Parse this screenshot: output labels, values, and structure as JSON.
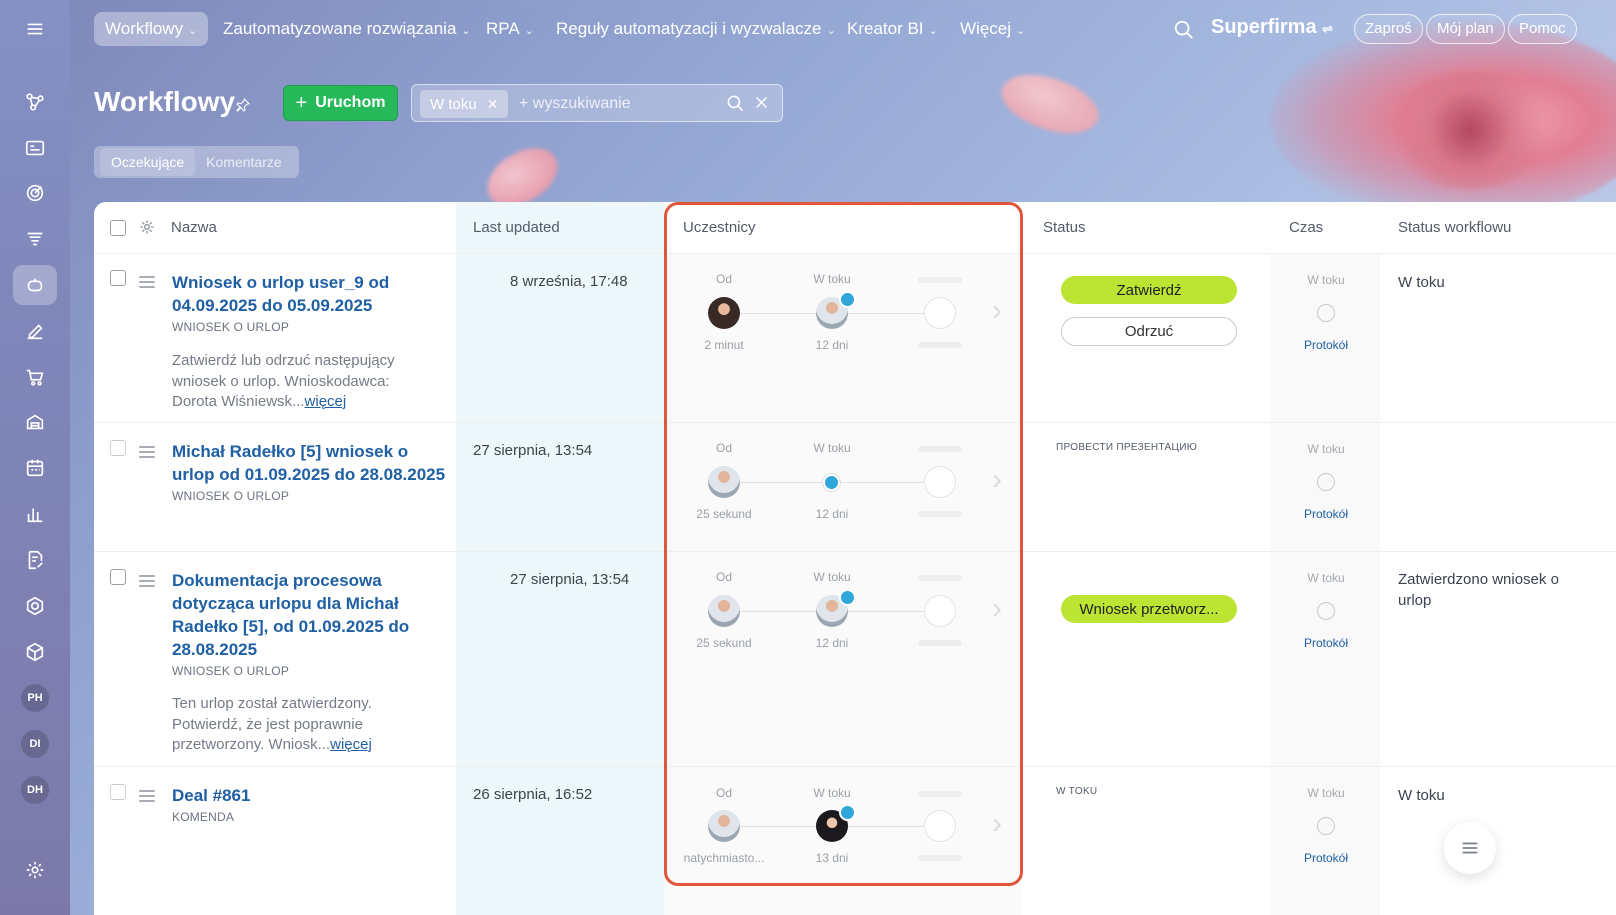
{
  "topnav": {
    "items": [
      {
        "label": "Workflowy",
        "active": true
      },
      {
        "label": "Zautomatyzowane rozwiązania"
      },
      {
        "label": "RPA"
      },
      {
        "label": "Reguły automatyzacji i wyzwalacze"
      },
      {
        "label": "Kreator BI"
      },
      {
        "label": "Więcej"
      }
    ],
    "brand": "Superfirma",
    "invite": "Zaproś",
    "my_plan": "Mój plan",
    "help": "Pomoc"
  },
  "sidebar": {
    "badges": [
      "PH",
      "DI",
      "DH"
    ]
  },
  "page": {
    "title": "Workflowy",
    "run_button": "Uruchom",
    "filter_chip": "W toku",
    "search_placeholder": "+ wyszukiwanie",
    "subtabs": [
      "Oczekujące",
      "Komentarze"
    ]
  },
  "table": {
    "headers": {
      "name": "Nazwa",
      "last_updated": "Last updated",
      "participants": "Uczestnicy",
      "status": "Status",
      "time": "Czas",
      "workflow_status": "Status workflowu"
    },
    "rows": [
      {
        "title": "Wniosek o urlop user_9 od 04.09.2025 do 05.09.2025",
        "type": "WNIOSEK O URLOP",
        "desc": "Zatwierdź lub odrzuć następujący wniosek o urlop. Wnioskodawca: Dorota Wiśniewsk...",
        "more": "więcej",
        "updated": "8 września, 17:48",
        "from_label": "Od",
        "from_time": "2 minut",
        "inprogress_label": "W toku",
        "inprogress_time": "12 dni",
        "approve": "Zatwierdź",
        "reject": "Odrzuć",
        "time_label": "W toku",
        "protocol": "Protokół",
        "wf_status": "W toku"
      },
      {
        "title": "Michał Radełko [5] wniosek o urlop od 01.09.2025 do 28.08.2025",
        "type": "WNIOSEK O URLOP",
        "updated": "27 sierpnia, 13:54",
        "from_label": "Od",
        "from_time": "25 sekund",
        "inprogress_label": "W toku",
        "inprogress_time": "12 dni",
        "status_text": "ПРОВЕСТИ ПРЕЗЕНТАЦИЮ",
        "time_label": "W toku",
        "protocol": "Protokół"
      },
      {
        "title": "Dokumentacja procesowa dotycząca urlopu dla Michał Radełko [5], od 01.09.2025 do 28.08.2025",
        "type": "WNIOSEK O URLOP",
        "desc": "Ten urlop został zatwierdzony. Potwierdź, że jest poprawnie przetworzony. Wniosk...",
        "more": "więcej",
        "updated": "27 sierpnia, 13:54",
        "from_label": "Od",
        "from_time": "25 sekund",
        "inprogress_label": "W toku",
        "inprogress_time": "12 dni",
        "status_button": "Wniosek przetworz...",
        "time_label": "W toku",
        "protocol": "Protokół",
        "wf_status": "Zatwierdzono wniosek o urlop"
      },
      {
        "title": "Deal #861",
        "type": "KOMENDA",
        "updated": "26 sierpnia, 16:52",
        "from_label": "Od",
        "from_time": "natychmiasto...",
        "inprogress_label": "W toku",
        "inprogress_time": "13 dni",
        "status_text": "W TOKU",
        "time_label": "W toku",
        "protocol": "Protokół",
        "wf_status": "W toku"
      }
    ]
  },
  "colors": {
    "accent_green": "#27b85a",
    "approve_lime": "#bbe532",
    "link_blue": "#1f5fa3",
    "highlight_red": "#e1563b",
    "clock_blue": "#2fa8d9"
  }
}
